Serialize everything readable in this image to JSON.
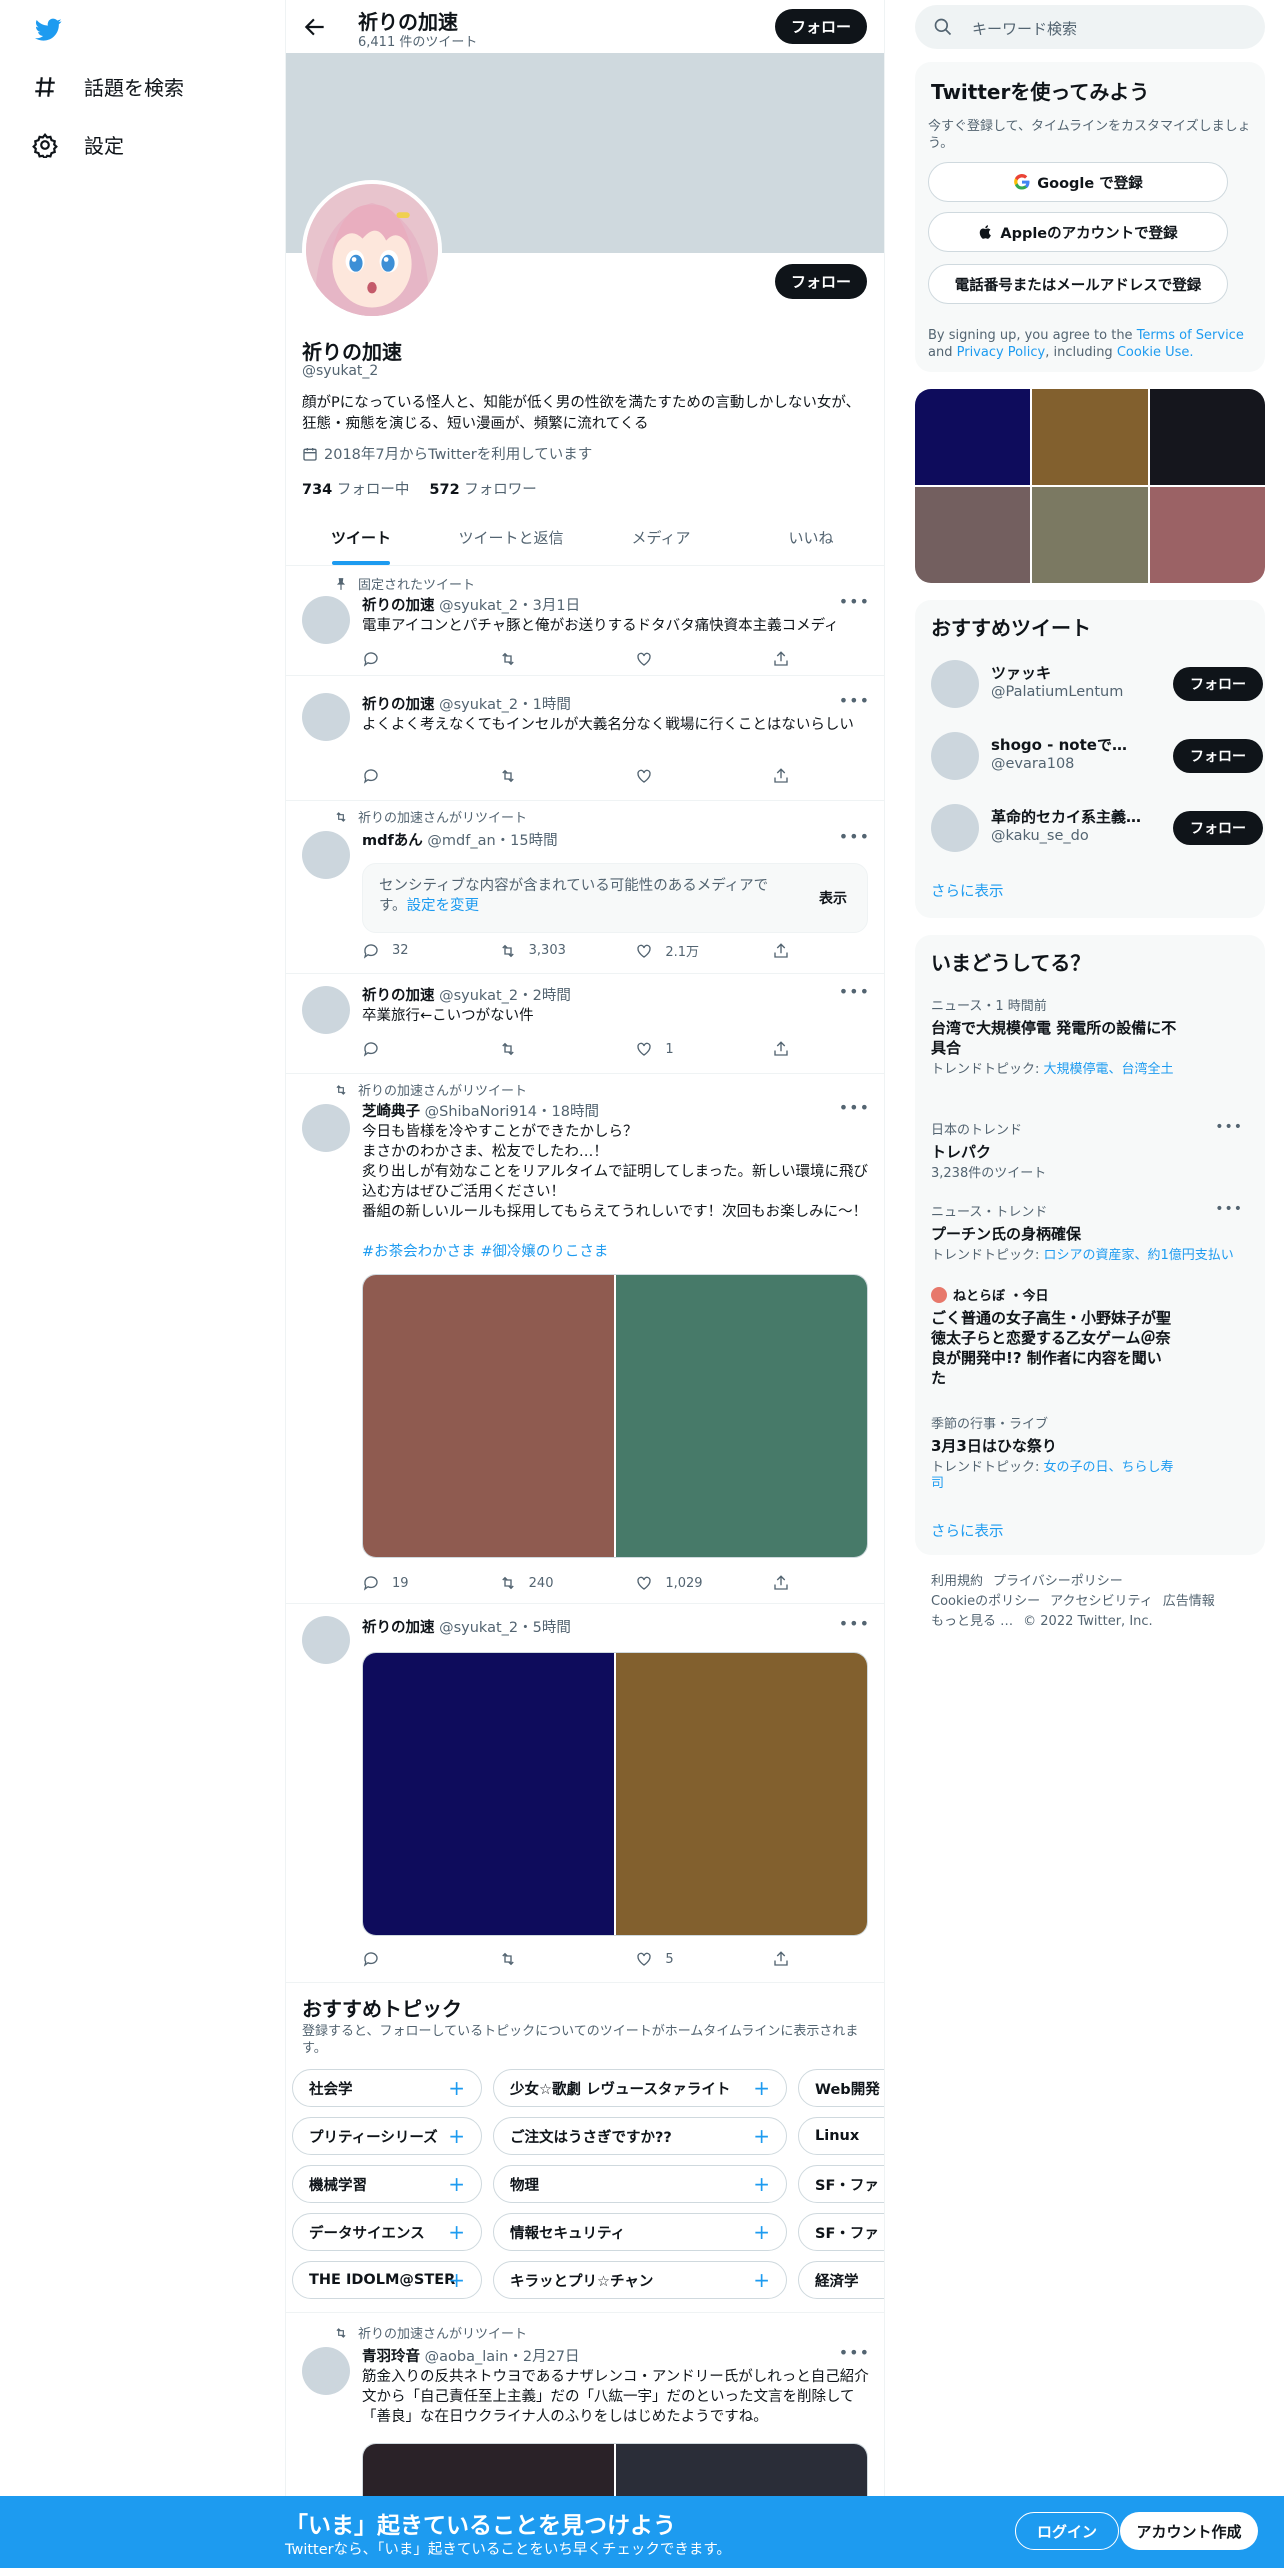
{
  "nav": {
    "logo": "twitter-bird-icon",
    "explore_label": "話題を検索",
    "settings_label": "設定"
  },
  "header": {
    "title": "祈りの加速",
    "tweet_count": "6,411 件のツイート",
    "follow_label": "フォロー"
  },
  "profile": {
    "name": "祈りの加速",
    "handle": "@syukat_2",
    "bio": "顔がPになっている怪人と、知能が低く男の性欲を満たすための言動しかしない女が、狂態・痴態を演じる、短い漫画が、頻繁に流れてくる",
    "joined": "2018年7月からTwitterを利用しています",
    "following_count": "734",
    "following_label": "フォロー中",
    "followers_count": "572",
    "followers_label": "フォロワー",
    "follow_label": "フォロー"
  },
  "tabs": [
    "ツイート",
    "ツイートと返信",
    "メディア",
    "いいね"
  ],
  "tweets": [
    {
      "social": "固定されたツイート",
      "name": "祈りの加速",
      "meta": "@syukat_2・3月1日",
      "text": "電車アイコンとパチャ豚と俺がお送りするドタバタ痛快資本主義コメディ",
      "reply": "",
      "retweet": "",
      "like": ""
    },
    {
      "name": "祈りの加速",
      "meta": "@syukat_2・1時間",
      "text": "よくよく考えなくてもインセルが大義名分なく戦場に行くことはないらしい",
      "reply": "",
      "retweet": "",
      "like": ""
    },
    {
      "social": "祈りの加速さんがリツイート",
      "name": "mdfあん",
      "meta": "@mdf_an・15時間",
      "sensitive_text": "センシティブな内容が含まれている可能性のあるメディアです。",
      "sensitive_link": "設定を変更",
      "sensitive_button": "表示",
      "reply": "32",
      "retweet": "3,303",
      "like": "2.1万"
    },
    {
      "name": "祈りの加速",
      "meta": "@syukat_2・2時間",
      "text": "卒業旅行←こいつがない件",
      "reply": "",
      "retweet": "",
      "like": "1"
    },
    {
      "social": "祈りの加速さんがリツイート",
      "name": "芝崎典子",
      "meta": "@ShibaNori914・18時間",
      "text": "今日も皆様を冷やすことができたかしら？\nまさかのわかさま、松友でしたわ…！\n炙り出しが有効なことをリアルタイムで証明してしまった。新しい環境に飛び込む方はぜひご活用ください！\n番組の新しいルールも採用してもらえてうれしいです！次回もお楽しみに～！",
      "hashtags": "#お茶会わかさま #御冷嬢のりこさま",
      "media_colors": [
        "#8f5b50",
        "#477a69"
      ],
      "reply": "19",
      "retweet": "240",
      "like": "1,029"
    },
    {
      "name": "祈りの加速",
      "meta": "@syukat_2・5時間",
      "media_colors": [
        "#0e0c5c",
        "#82602e"
      ],
      "reply": "",
      "retweet": "",
      "like": "5"
    },
    {
      "social": "祈りの加速さんがリツイート",
      "name": "青羽玲音",
      "meta": "@aoba_lain・2月27日",
      "text": "筋金入りの反共ネトウヨであるナザレンコ・アンドリー氏がしれっと自己紹介文から「自己責任至上主義」だの「八紘一宇」だのといった文言を削除して「善良」な在日ウクライナ人のふりをしはじめたようですね。",
      "media_colors": [
        "#2a2228",
        "#2a2d38"
      ]
    }
  ],
  "topics": {
    "title": "おすすめトピック",
    "desc": "登録すると、フォローしているトピックについてのツイートがホームタイムラインに表示されます。",
    "rows": [
      [
        "社会学",
        "少女☆歌劇 レヴュースタァライト",
        "Web開発"
      ],
      [
        "プリティーシリーズ",
        "ご注文はうさぎですか??",
        "Linux"
      ],
      [
        "機械学習",
        "物理",
        "SF・ファ"
      ],
      [
        "データサイエンス",
        "情報セキュリティ",
        "SF・ファ"
      ],
      [
        "THE IDOLM@STER",
        "キラッとプリ☆チャン",
        "経済学"
      ]
    ]
  },
  "search": {
    "placeholder": "キーワード検索"
  },
  "signup": {
    "title": "Twitterを使ってみよう",
    "sub": "今すぐ登録して、タイムラインをカスタマイズしましょう。",
    "google": "Google で登録",
    "apple": "Appleのアカウントで登録",
    "phone": "電話番号またはメールアドレスで登録",
    "legal_1": "By signing up, you agree to the",
    "tos": "Terms of Service",
    "legal_2": "and",
    "privacy": "Privacy Policy",
    "legal_3": ", including",
    "cookie": "Cookie Use."
  },
  "media_grid_colors": [
    "#0e0c5c",
    "#82602e",
    "#15161d",
    "#735f5f",
    "#7b7962",
    "#9b6265"
  ],
  "who": {
    "title": "おすすめツイート",
    "users": [
      {
        "name": "ツァッキ",
        "handle": "@PalatiumLentum"
      },
      {
        "name": "shogo - noteで日記…",
        "handle": "@evara108"
      },
      {
        "name": "革命的セカイ系主義…",
        "handle": "@kaku_se_do"
      }
    ],
    "follow_label": "フォロー",
    "more": "さらに表示"
  },
  "trends": {
    "title": "いまどうしてる？",
    "items": [
      {
        "ctx": "ニュース・1 時間前",
        "name": "台湾で大規模停電 発電所の設備に不具合",
        "sub_label": "トレンドトピック: ",
        "sub_link": "大規模停電、台湾全土"
      },
      {
        "ctx": "日本のトレンド",
        "name": "トレパク",
        "sub_label": "3,238件のツイート",
        "sub_link": ""
      },
      {
        "ctx": "ニュース・トレンド",
        "name": "プーチン氏の身柄確保",
        "sub_label": "トレンドトピック: ",
        "sub_link": "ロシアの資産家、約1億円支払い"
      },
      {
        "ctx": "ねとらぼ ・今日",
        "name": "ごく普通の女子高生・小野妹子が聖徳太子らと恋愛する乙女ゲーム＠奈良が開発中!? 制作者に内容を聞いた",
        "sub_label": "",
        "sub_link": ""
      },
      {
        "ctx": "季節の行事・ライブ",
        "name": "3月3日はひな祭り",
        "sub_label": "トレンドトピック: ",
        "sub_link": "女の子の日、ちらし寿司"
      }
    ],
    "more": "さらに表示"
  },
  "footer": [
    "利用規約",
    "プライバシーポリシー",
    "Cookieのポリシー",
    "アクセシビリティ",
    "広告情報",
    "もっと見る …",
    "© 2022 Twitter, Inc."
  ],
  "bottom": {
    "title": "「いま」起きていることを見つけよう",
    "sub": "Twitterなら、「いま」起きていることをいち早くチェックできます。",
    "login": "ログイン",
    "signup": "アカウント作成"
  },
  "colors": {
    "accent": "#1d9bf0",
    "dark": "#0f1419",
    "muted": "#536471",
    "banner": "#cfd9de"
  }
}
